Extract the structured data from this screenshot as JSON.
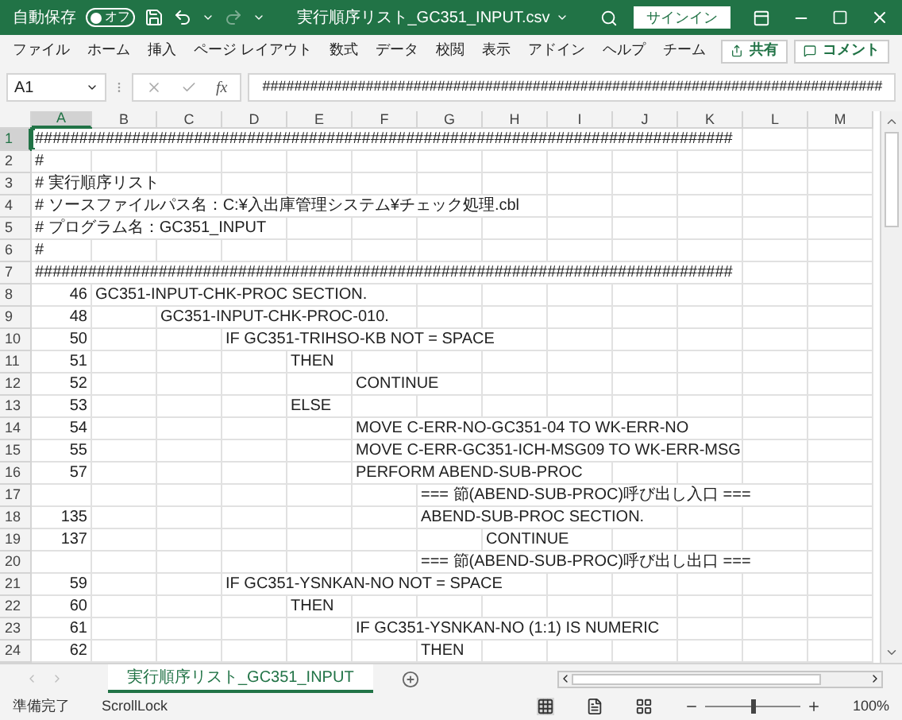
{
  "title_bar": {
    "autosave_label": "自動保存",
    "autosave_toggle": {
      "label": "オフ",
      "on": false
    },
    "redo_disabled": true,
    "title": "実行順序リスト_GC351_INPUT.csv",
    "signin": "サインイン"
  },
  "ribbon_tabs": [
    "ファイル",
    "ホーム",
    "挿入",
    "ページ レイアウト",
    "数式",
    "データ",
    "校閲",
    "表示",
    "アドイン",
    "ヘルプ",
    "チーム"
  ],
  "share": "共有",
  "comment": "コメント",
  "formula_bar": {
    "name_box": "A1",
    "function_label": "fx",
    "value": "##############################################################################"
  },
  "columns": [
    {
      "label": "A",
      "selected": true
    },
    {
      "label": "B",
      "selected": false
    },
    {
      "label": "C",
      "selected": false
    },
    {
      "label": "D",
      "selected": false
    },
    {
      "label": "E",
      "selected": false
    },
    {
      "label": "F",
      "selected": false
    },
    {
      "label": "G",
      "selected": false
    },
    {
      "label": "H",
      "selected": false
    },
    {
      "label": "I",
      "selected": false
    },
    {
      "label": "J",
      "selected": false
    },
    {
      "label": "K",
      "selected": false
    },
    {
      "label": "L",
      "selected": false
    },
    {
      "label": "M",
      "selected": false
    }
  ],
  "rows": [
    {
      "number": "1",
      "selected": true,
      "a": "###############################################################################"
    },
    {
      "number": "2",
      "selected": false,
      "a": "#"
    },
    {
      "number": "3",
      "selected": false,
      "a": "#  実行順序リスト"
    },
    {
      "number": "4",
      "selected": false,
      "a": "#    ソースファイルパス名：C:¥入出庫管理システム¥チェック処理.cbl"
    },
    {
      "number": "5",
      "selected": false,
      "a": "#    プログラム名：GC351_INPUT"
    },
    {
      "number": "6",
      "selected": false,
      "a": "#"
    },
    {
      "number": "7",
      "selected": false,
      "a": "###############################################################################"
    },
    {
      "number": "8",
      "selected": false,
      "a": "46",
      "b": "GC351-INPUT-CHK-PROC SECTION."
    },
    {
      "number": "9",
      "selected": false,
      "a": "48",
      "c": "GC351-INPUT-CHK-PROC-010."
    },
    {
      "number": "10",
      "selected": false,
      "a": "50",
      "d": "IF GC351-TRIHSO-KB NOT = SPACE"
    },
    {
      "number": "11",
      "selected": false,
      "a": "51",
      "e": "THEN"
    },
    {
      "number": "12",
      "selected": false,
      "a": "52",
      "f": "CONTINUE"
    },
    {
      "number": "13",
      "selected": false,
      "a": "53",
      "e": "ELSE"
    },
    {
      "number": "14",
      "selected": false,
      "a": "54",
      "f": "MOVE C-ERR-NO-GC351-04 TO WK-ERR-NO"
    },
    {
      "number": "15",
      "selected": false,
      "a": "55",
      "f": "MOVE C-ERR-GC351-ICH-MSG09 TO WK-ERR-MSG"
    },
    {
      "number": "16",
      "selected": false,
      "a": "57",
      "f": "PERFORM ABEND-SUB-PROC"
    },
    {
      "number": "17",
      "selected": false,
      "g": "=== 節(ABEND-SUB-PROC)呼び出し入口 ==="
    },
    {
      "number": "18",
      "selected": false,
      "a": "135",
      "g": "ABEND-SUB-PROC SECTION."
    },
    {
      "number": "19",
      "selected": false,
      "a": "137",
      "h": "CONTINUE"
    },
    {
      "number": "20",
      "selected": false,
      "g": "=== 節(ABEND-SUB-PROC)呼び出し出口 ==="
    },
    {
      "number": "21",
      "selected": false,
      "a": "59",
      "d": "IF GC351-YSNKAN-NO NOT = SPACE"
    },
    {
      "number": "22",
      "selected": false,
      "a": "60",
      "e": "THEN"
    },
    {
      "number": "23",
      "selected": false,
      "a": "61",
      "f": "IF GC351-YSNKAN-NO (1:1) IS NUMERIC"
    },
    {
      "number": "24",
      "selected": false,
      "a": "62",
      "g": "THEN"
    }
  ],
  "sheet_tab": {
    "label": "実行順序リスト_GC351_INPUT",
    "selected": true
  },
  "status_bar": {
    "ready": "準備完了",
    "scroll_lock": "ScrollLock",
    "zoom": {
      "level": 0.5
    },
    "zoom_label": "100%"
  }
}
